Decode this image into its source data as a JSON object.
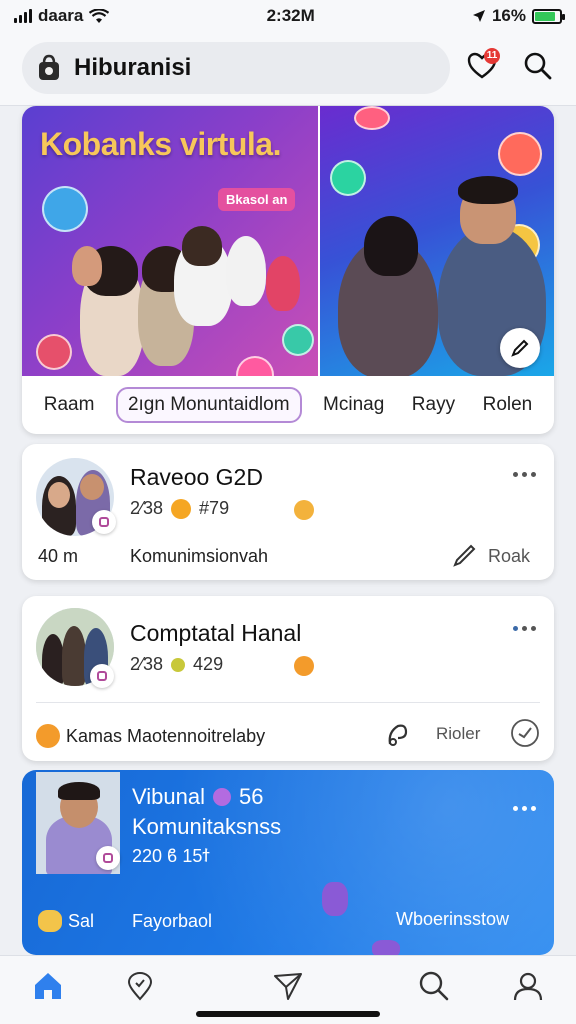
{
  "status_bar": {
    "carrier": "daara",
    "time": "2:32M",
    "battery_text": "16%",
    "battery_level": 0.85,
    "colors": {
      "battery": "#34c759"
    }
  },
  "header": {
    "title": "Hiburanisi",
    "notification_count": "11",
    "app_icon": "bag-icon",
    "search_icon": "search-icon",
    "notification_icon": "heart-bell-icon"
  },
  "hero": {
    "headline": "Kobanks virtula.",
    "tag": "Bkasol an",
    "tabs": [
      "Raam",
      "2ıgn  Monuntaidlom",
      "Mcinag",
      "Rayy",
      "Rolen"
    ],
    "active_tab_index": 1,
    "colors": {
      "headline": "#f7c75a",
      "tag_bg": "#e4509f",
      "active_tab_border": "#b48ad6"
    }
  },
  "cards": [
    {
      "title": "Raveoo G2D",
      "stats_a": "2⁄38",
      "stats_b": "#79",
      "footer_left": "40 m",
      "footer_mid": "Komunimsionvah",
      "footer_right": "Roak"
    },
    {
      "title": "Comptatal Hanal",
      "stats_a": "2⁄38",
      "stats_b": "429",
      "footer_left": "Kamas Maotennoitrelaby",
      "footer_right": "Rioler"
    },
    {
      "title_line1": "Vibunal",
      "title_line1_suffix": "56",
      "title_line2": "Komunitaksnss",
      "stats": "220  ϐ  15ϯ",
      "footer_left": "Sal",
      "footer_mid": "Fayorbaol",
      "footer_right": "Wboerinsstow"
    }
  ],
  "bottom_nav": {
    "items": [
      "home-icon",
      "location-icon",
      "send-icon",
      "search-icon",
      "profile-icon"
    ],
    "active_index": 0,
    "colors": {
      "active": "#2f80ed"
    }
  }
}
